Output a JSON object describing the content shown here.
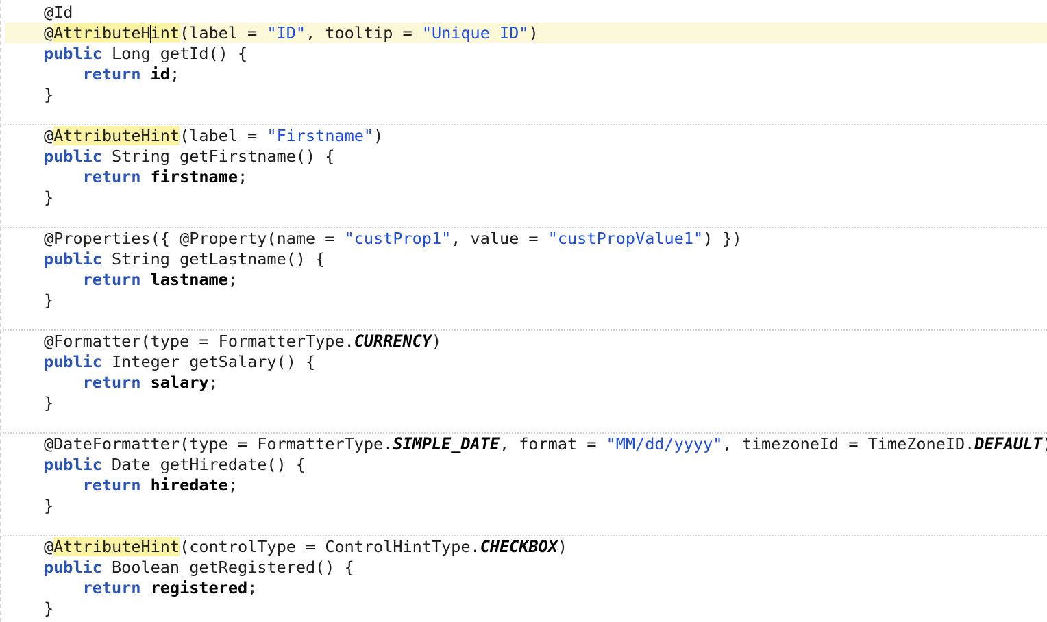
{
  "editor": {
    "lines": [
      {
        "tokens": [
          {
            "t": "@Id",
            "c": "plain"
          }
        ]
      },
      {
        "current": true,
        "tokens": [
          {
            "t": "@",
            "c": "plain"
          },
          {
            "t": "AttributeH",
            "c": "ann-hl"
          },
          {
            "caret": true
          },
          {
            "t": "int",
            "c": "ann-hl"
          },
          {
            "t": "(label = ",
            "c": "plain"
          },
          {
            "t": "\"ID\"",
            "c": "str"
          },
          {
            "t": ", tooltip = ",
            "c": "plain"
          },
          {
            "t": "\"Unique ID\"",
            "c": "str"
          },
          {
            "t": ")",
            "c": "plain"
          }
        ]
      },
      {
        "tokens": [
          {
            "t": "public",
            "c": "kw"
          },
          {
            "t": " Long getId() {",
            "c": "plain"
          }
        ]
      },
      {
        "tokens": [
          {
            "t": "    ",
            "c": "plain"
          },
          {
            "t": "return",
            "c": "kw"
          },
          {
            "t": " ",
            "c": "plain"
          },
          {
            "t": "id",
            "c": "field"
          },
          {
            "t": ";",
            "c": "plain"
          }
        ]
      },
      {
        "tokens": [
          {
            "t": "}",
            "c": "plain"
          }
        ]
      },
      {
        "tokens": []
      },
      {
        "tokens": [
          {
            "t": "@",
            "c": "plain"
          },
          {
            "t": "AttributeHint",
            "c": "ann-hl"
          },
          {
            "t": "(label = ",
            "c": "plain"
          },
          {
            "t": "\"Firstname\"",
            "c": "str"
          },
          {
            "t": ")",
            "c": "plain"
          }
        ]
      },
      {
        "tokens": [
          {
            "t": "public",
            "c": "kw"
          },
          {
            "t": " String getFirstname() {",
            "c": "plain"
          }
        ]
      },
      {
        "tokens": [
          {
            "t": "    ",
            "c": "plain"
          },
          {
            "t": "return",
            "c": "kw"
          },
          {
            "t": " ",
            "c": "plain"
          },
          {
            "t": "firstname",
            "c": "field"
          },
          {
            "t": ";",
            "c": "plain"
          }
        ]
      },
      {
        "tokens": [
          {
            "t": "}",
            "c": "plain"
          }
        ]
      },
      {
        "tokens": []
      },
      {
        "tokens": [
          {
            "t": "@Properties({ @Property(name = ",
            "c": "plain"
          },
          {
            "t": "\"custProp1\"",
            "c": "str"
          },
          {
            "t": ", value = ",
            "c": "plain"
          },
          {
            "t": "\"custPropValue1\"",
            "c": "str"
          },
          {
            "t": ") })",
            "c": "plain"
          }
        ]
      },
      {
        "tokens": [
          {
            "t": "public",
            "c": "kw"
          },
          {
            "t": " String getLastname() {",
            "c": "plain"
          }
        ]
      },
      {
        "tokens": [
          {
            "t": "    ",
            "c": "plain"
          },
          {
            "t": "return",
            "c": "kw"
          },
          {
            "t": " ",
            "c": "plain"
          },
          {
            "t": "lastname",
            "c": "field"
          },
          {
            "t": ";",
            "c": "plain"
          }
        ]
      },
      {
        "tokens": [
          {
            "t": "}",
            "c": "plain"
          }
        ]
      },
      {
        "tokens": []
      },
      {
        "tokens": [
          {
            "t": "@Formatter(type = FormatterType.",
            "c": "plain"
          },
          {
            "t": "CURRENCY",
            "c": "const"
          },
          {
            "t": ")",
            "c": "plain"
          }
        ]
      },
      {
        "tokens": [
          {
            "t": "public",
            "c": "kw"
          },
          {
            "t": " Integer getSalary() {",
            "c": "plain"
          }
        ]
      },
      {
        "tokens": [
          {
            "t": "    ",
            "c": "plain"
          },
          {
            "t": "return",
            "c": "kw"
          },
          {
            "t": " ",
            "c": "plain"
          },
          {
            "t": "salary",
            "c": "field"
          },
          {
            "t": ";",
            "c": "plain"
          }
        ]
      },
      {
        "tokens": [
          {
            "t": "}",
            "c": "plain"
          }
        ]
      },
      {
        "tokens": []
      },
      {
        "tokens": [
          {
            "t": "@DateFormatter(type = FormatterType.",
            "c": "plain"
          },
          {
            "t": "SIMPLE_DATE",
            "c": "const"
          },
          {
            "t": ", format = ",
            "c": "plain"
          },
          {
            "t": "\"MM/dd/yyyy\"",
            "c": "str"
          },
          {
            "t": ", timezoneId = TimeZoneID.",
            "c": "plain"
          },
          {
            "t": "DEFAULT",
            "c": "const"
          },
          {
            "t": ")",
            "c": "plain"
          }
        ]
      },
      {
        "tokens": [
          {
            "t": "public",
            "c": "kw"
          },
          {
            "t": " Date getHiredate() {",
            "c": "plain"
          }
        ]
      },
      {
        "tokens": [
          {
            "t": "    ",
            "c": "plain"
          },
          {
            "t": "return",
            "c": "kw"
          },
          {
            "t": " ",
            "c": "plain"
          },
          {
            "t": "hiredate",
            "c": "field"
          },
          {
            "t": ";",
            "c": "plain"
          }
        ]
      },
      {
        "tokens": [
          {
            "t": "}",
            "c": "plain"
          }
        ]
      },
      {
        "tokens": []
      },
      {
        "tokens": [
          {
            "t": "@",
            "c": "plain"
          },
          {
            "t": "AttributeHint",
            "c": "ann-hl"
          },
          {
            "t": "(controlType = ControlHintType.",
            "c": "plain"
          },
          {
            "t": "CHECKBOX",
            "c": "const"
          },
          {
            "t": ")",
            "c": "plain"
          }
        ]
      },
      {
        "tokens": [
          {
            "t": "public",
            "c": "kw"
          },
          {
            "t": " Boolean getRegistered() {",
            "c": "plain"
          }
        ]
      },
      {
        "tokens": [
          {
            "t": "    ",
            "c": "plain"
          },
          {
            "t": "return",
            "c": "kw"
          },
          {
            "t": " ",
            "c": "plain"
          },
          {
            "t": "registered",
            "c": "field"
          },
          {
            "t": ";",
            "c": "plain"
          }
        ]
      },
      {
        "tokens": [
          {
            "t": "}",
            "c": "plain"
          }
        ]
      }
    ],
    "method_separators_after_line": [
      5,
      10,
      15,
      20,
      25
    ],
    "colors": {
      "keyword": "#2b55b4",
      "string": "#1e4fe0",
      "annotation_highlight": "#fbf4a4",
      "current_line": "#fcf8d8"
    }
  }
}
